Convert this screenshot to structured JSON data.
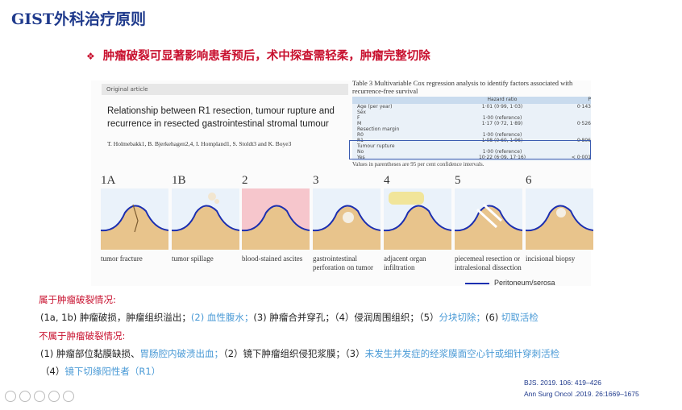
{
  "slide": {
    "title": "GIST外科治疗原则",
    "bullet": "肿瘤破裂可显著影响患者预后，术中探查需轻柔，肿瘤完整切除"
  },
  "paper": {
    "label": "Original article",
    "title": "Relationship between R1 resection, tumour rupture and recurrence in resected gastrointestinal stromal tumour",
    "authors": "T. Holmebakk1, B. Bjerkehagen2,4, I. Hompland1, S. Stoldt3 and K. Boye3"
  },
  "table": {
    "caption": "Table 3 Multivariable Cox regression analysis to identify factors associated with recurrence-free survival",
    "header": [
      "",
      "Hazard ratio",
      "P"
    ],
    "rows": [
      [
        "Age (per year)",
        "1·01 (0·99, 1·03)",
        "0·143"
      ],
      [
        "Sex",
        "",
        ""
      ],
      [
        "F",
        "1·00 (reference)",
        ""
      ],
      [
        "M",
        "1·17 (0·72, 1·89)",
        "0·526"
      ],
      [
        "Resection margin",
        "",
        ""
      ],
      [
        "R0",
        "1·00 (reference)",
        ""
      ],
      [
        "R1",
        "1·08 (0·60, 1·96)",
        "0·806"
      ],
      [
        "Tumour rupture",
        "",
        ""
      ],
      [
        "No",
        "1·00 (reference)",
        ""
      ],
      [
        "Yes",
        "10·22 (6·09, 17·16)",
        "< 0·001"
      ]
    ],
    "footnote": "Values in parentheses are 95 per cent confidence intervals."
  },
  "panels": [
    {
      "num": "1A",
      "caption": "tumor fracture"
    },
    {
      "num": "1B",
      "caption": "tumor spillage"
    },
    {
      "num": "2",
      "caption": "blood-stained ascites"
    },
    {
      "num": "3",
      "caption": "gastrointestinal perforation on tumor"
    },
    {
      "num": "4",
      "caption": "adjacent organ infiltration"
    },
    {
      "num": "5",
      "caption": "piecemeal resection or intralesional dissection"
    },
    {
      "num": "6",
      "caption": "incisional biopsy"
    }
  ],
  "legend": "Peritoneum/serosa",
  "rupture_heading": "属于肿瘤破裂情况:",
  "rupture_line_a": "(1a, 1b) 肿瘤破损，肿瘤组织溢出；",
  "rupture_line_b": "(2) 血性腹水；",
  "rupture_line_c": "(3) 肿瘤合并穿孔；（4）侵润周围组织；（5）",
  "rupture_line_d": "分块切除；",
  "rupture_line_e": "(6) ",
  "rupture_line_f": "切取活检",
  "nonrupture_heading": "不属于肿瘤破裂情况:",
  "non_line1_a": "(1) 肿瘤部位黏膜缺损、",
  "non_line1_b": "胃肠腔内破溃出血；",
  "non_line1_c": "（2）镜下肿瘤组织侵犯浆膜；（3）",
  "non_line1_d": "未发生并发症的经浆膜面空心针或细针穿刺活检",
  "non_line2_a": "（4）",
  "non_line2_b": "镜下切缘阳性者（R1）",
  "citations": [
    "BJS. 2019. 106: 419–426",
    "Ann Surg Oncol .2019. 26:1669–1675"
  ],
  "colors": {
    "title": "#1f3a8c",
    "accent_red": "#c8102e",
    "accent_blue": "#4a9ad6",
    "serosa": "#1c2fb0"
  }
}
